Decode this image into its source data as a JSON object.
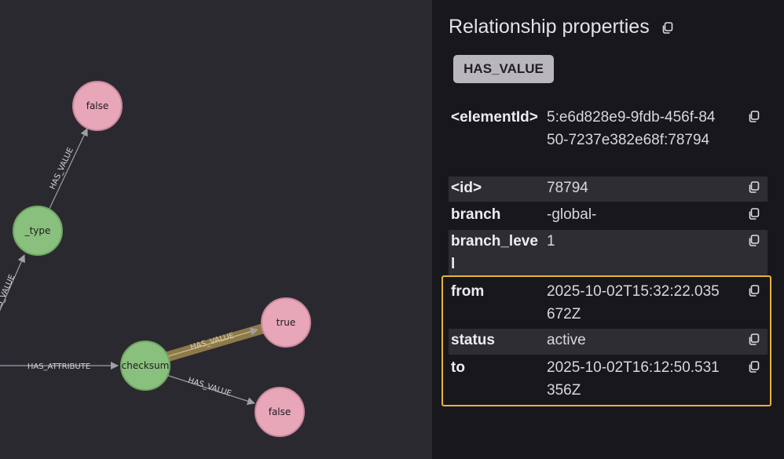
{
  "graph": {
    "nodes": [
      {
        "id": "false-top",
        "label": "false",
        "kind": "value"
      },
      {
        "id": "type",
        "label": "_type",
        "kind": "attribute"
      },
      {
        "id": "true",
        "label": "true",
        "kind": "value"
      },
      {
        "id": "checksum",
        "label": "checksum",
        "kind": "attribute"
      },
      {
        "id": "false-bottom",
        "label": "false",
        "kind": "value"
      }
    ],
    "edges": [
      {
        "id": "type-false",
        "label": "HAS_VALUE"
      },
      {
        "id": "left-type",
        "label": "HAS_VALUE"
      },
      {
        "id": "left-checksum",
        "label": "HAS_ATTRIBUTE"
      },
      {
        "id": "checksum-true",
        "label": "HAS_VALUE",
        "selected": true
      },
      {
        "id": "checksum-false",
        "label": "HAS_VALUE"
      }
    ],
    "colors": {
      "value_node": "#e7a7b8",
      "attribute_node": "#89c07d",
      "edge": "#a19fa6",
      "selected_edge": "#8d7a4a"
    }
  },
  "panel": {
    "title": "Relationship properties",
    "badge": "HAS_VALUE",
    "properties": [
      {
        "key": "<elementId>",
        "value": "5:e6d828e9-9fdb-456f-8450-7237e382e68f:78794"
      },
      {
        "key": "<id>",
        "value": "78794"
      },
      {
        "key": "branch",
        "value": "-global-"
      },
      {
        "key": "branch_level",
        "value": "1"
      },
      {
        "key": "from",
        "value": "2025-10-02T15:32:22.035672Z"
      },
      {
        "key": "status",
        "value": "active"
      },
      {
        "key": "to",
        "value": "2025-10-02T16:12:50.531356Z"
      }
    ]
  },
  "highlight_color": "#e5b43c"
}
